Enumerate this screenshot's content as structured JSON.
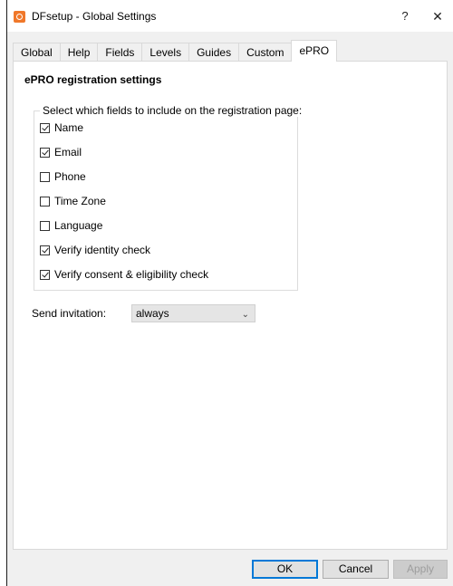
{
  "window": {
    "title": "DFsetup - Global Settings",
    "help_glyph": "?",
    "close_glyph": "✕"
  },
  "tabs": [
    {
      "label": "Global",
      "active": false
    },
    {
      "label": "Help",
      "active": false
    },
    {
      "label": "Fields",
      "active": false
    },
    {
      "label": "Levels",
      "active": false
    },
    {
      "label": "Guides",
      "active": false
    },
    {
      "label": "Custom",
      "active": false
    },
    {
      "label": "ePRO",
      "active": true
    }
  ],
  "panel": {
    "title": "ePRO registration settings",
    "group_label": "Select which fields to include on the registration page:",
    "fields": [
      {
        "label": "Name",
        "checked": true
      },
      {
        "label": "Email",
        "checked": true
      },
      {
        "label": "Phone",
        "checked": false
      },
      {
        "label": "Time Zone",
        "checked": false
      },
      {
        "label": "Language",
        "checked": false
      },
      {
        "label": "Verify identity check",
        "checked": true
      },
      {
        "label": "Verify consent & eligibility check",
        "checked": true
      }
    ],
    "invitation": {
      "label": "Send invitation:",
      "value": "always"
    }
  },
  "buttons": {
    "ok": "OK",
    "cancel": "Cancel",
    "apply": "Apply"
  },
  "colors": {
    "app_icon": "#f0782a",
    "focus_border": "#0078d7"
  }
}
